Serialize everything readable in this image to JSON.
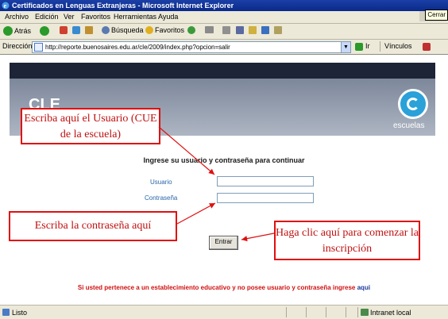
{
  "window": {
    "title": "Certificados en Lenguas Extranjeras - Microsoft Internet Explorer",
    "close_tooltip": "Cerrar"
  },
  "menu": [
    "Archivo",
    "Edición",
    "Ver",
    "Favoritos",
    "Herramientas",
    "Ayuda"
  ],
  "toolbar": {
    "back": "Atrás",
    "search": "Búsqueda",
    "favorites": "Favoritos"
  },
  "address": {
    "label": "Dirección",
    "url": "http://reporte.buenosaires.edu.ar/cle/2009/index.php?opcion=salir",
    "go": "Ir",
    "links": "Vínculos"
  },
  "page": {
    "logo_text": "escuelas",
    "banner_text": "CLE",
    "heading": "Ingrese su usuario y contraseña para continuar",
    "usuario_label": "Usuario",
    "contrasena_label": "Contraseña",
    "enter_button": "Entrar",
    "footer_text": "Si usted pertenece a un establecimiento educativo y no posee usuario y contraseña ingrese",
    "footer_link": "aqui"
  },
  "callouts": {
    "usuario": "Escriba aquí el Usuario (CUE de la escuela)",
    "contrasena": "Escriba la contraseña aquí",
    "entrar": "Haga clic aquí para comenzar la inscripción"
  },
  "status": {
    "left": "Listo",
    "zone": "Intranet local"
  },
  "colors": {
    "callout_border": "#e01010",
    "callout_text": "#c01010",
    "footer_red": "#d01010",
    "banner_dark": "#1d2437",
    "logo_blue": "#2aa1d8"
  }
}
